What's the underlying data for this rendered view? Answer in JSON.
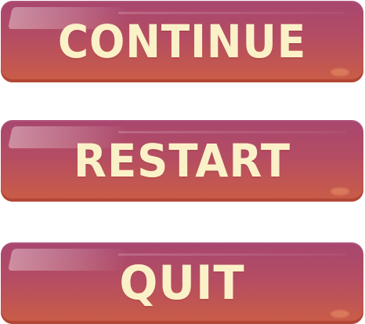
{
  "menu": {
    "buttons": [
      {
        "label": "CONTINUE"
      },
      {
        "label": "RESTART"
      },
      {
        "label": "QUIT"
      }
    ]
  },
  "theme": {
    "button_top_color": "#a8466f",
    "button_bottom_color": "#cb5d45",
    "label_color": "#fbf1c8"
  }
}
